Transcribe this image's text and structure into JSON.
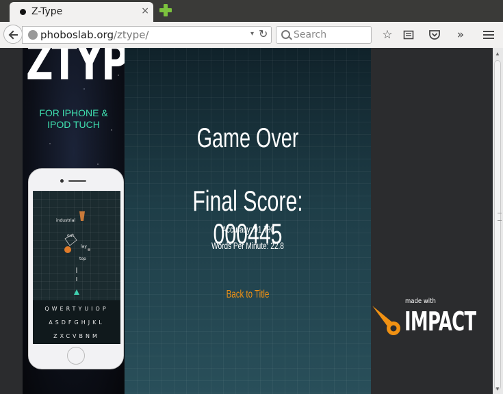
{
  "browser": {
    "tab_title": "Z-Type",
    "url_domain": "phoboslab.org",
    "url_path": "/ztype/",
    "search_placeholder": "Search",
    "close_glyph": "×"
  },
  "ad": {
    "logo": "ZTYPE",
    "tagline_line1": "FOR IPHONE &",
    "tagline_line2": "IPOD TUCH",
    "phone_words": [
      "industrial",
      "out",
      "lay",
      "top"
    ],
    "keyboard_rows": [
      "QWERTYUIOP",
      "ASDFGHJKL",
      "ZXCVBNM"
    ]
  },
  "game": {
    "title": "Game Over",
    "final_score_label": "Final Score: 000445",
    "accuracy": "Accuracy: 91.7%",
    "wpm": "Words Per Minute: 22.8",
    "back_to_title": "Back to Title",
    "accent_color": "#f09113"
  },
  "impact": {
    "made_with": "made with",
    "name": "IMPACT"
  }
}
